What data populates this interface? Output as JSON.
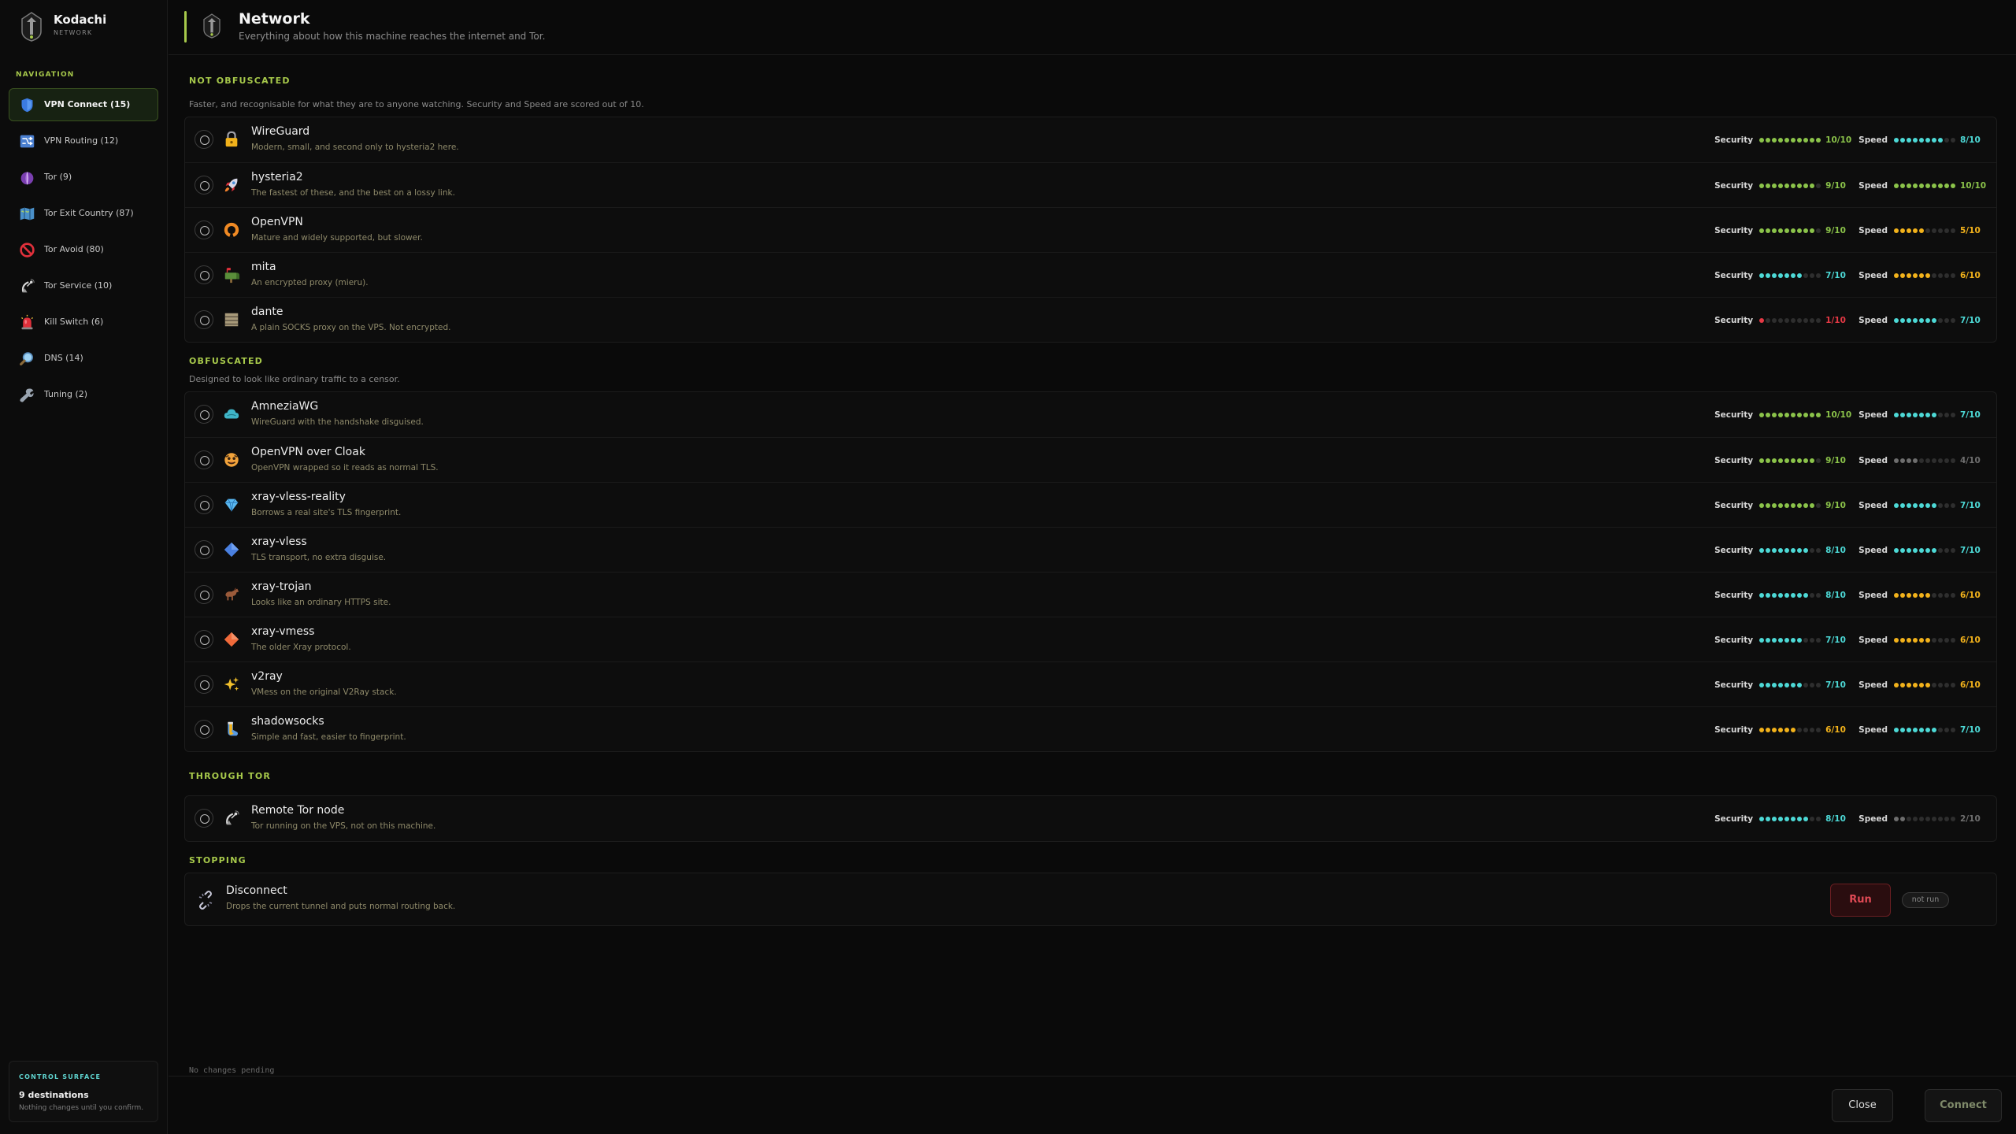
{
  "app": {
    "name": "Kodachi",
    "subtitle": "NETWORK"
  },
  "sidebar": {
    "heading": "NAVIGATION",
    "items": [
      {
        "label": "VPN Connect (15)",
        "icon": "shield-icon",
        "active": true
      },
      {
        "label": "VPN Routing (12)",
        "icon": "routing-icon",
        "active": false
      },
      {
        "label": "Tor (9)",
        "icon": "tor-onion-icon",
        "active": false
      },
      {
        "label": "Tor Exit Country (87)",
        "icon": "map-icon",
        "active": false
      },
      {
        "label": "Tor Avoid (80)",
        "icon": "prohibited-icon",
        "active": false
      },
      {
        "label": "Tor Service (10)",
        "icon": "satellite-icon",
        "active": false
      },
      {
        "label": "Kill Switch (6)",
        "icon": "alarm-icon",
        "active": false
      },
      {
        "label": "DNS (14)",
        "icon": "magnifier-icon",
        "active": false
      },
      {
        "label": "Tuning (2)",
        "icon": "wrench-icon",
        "active": false
      }
    ],
    "control": {
      "heading": "CONTROL SURFACE",
      "title": "9 destinations",
      "subtitle": "Nothing changes until you confirm."
    }
  },
  "header": {
    "title": "Network",
    "subtitle": "Everything about how this machine reaches the internet and Tor."
  },
  "labels": {
    "security": "Security",
    "speed": "Speed"
  },
  "colors": {
    "accent": "#a7c94b",
    "green": "#8bc34a",
    "cyan": "#4dd9d6",
    "yellow": "#f2b21b",
    "red": "#e53945",
    "gray": "#6e6e6e"
  },
  "sections": [
    {
      "heading": "NOT OBFUSCATED",
      "description": "Faster, and recognisable for what they are to anyone watching. Security and Speed are scored out of 10.",
      "protocols": [
        {
          "name": "WireGuard",
          "desc": "Modern, small, and second only to hysteria2 here.",
          "icon": "lock-icon",
          "security": 10,
          "speed": 8,
          "sec_color": "green",
          "spd_color": "cyan",
          "sec_text": "10/10",
          "spd_text": "8/10"
        },
        {
          "name": "hysteria2",
          "desc": "The fastest of these, and the best on a lossy link.",
          "icon": "rocket-icon",
          "security": 9,
          "speed": 10,
          "sec_color": "green",
          "spd_color": "green",
          "sec_text": "9/10",
          "spd_text": "10/10"
        },
        {
          "name": "OpenVPN",
          "desc": "Mature and widely supported, but slower.",
          "icon": "openvpn-icon",
          "security": 9,
          "speed": 5,
          "sec_color": "green",
          "spd_color": "yellow",
          "sec_text": "9/10",
          "spd_text": "5/10"
        },
        {
          "name": "mita",
          "desc": "An encrypted proxy (mieru).",
          "icon": "mailbox-icon",
          "security": 7,
          "speed": 6,
          "sec_color": "cyan",
          "spd_color": "yellow",
          "sec_text": "7/10",
          "spd_text": "6/10"
        },
        {
          "name": "dante",
          "desc": "A plain SOCKS proxy on the VPS. Not encrypted.",
          "icon": "server-icon",
          "security": 1,
          "speed": 7,
          "sec_color": "red",
          "spd_color": "cyan",
          "sec_text": "1/10",
          "spd_text": "7/10"
        }
      ]
    },
    {
      "heading": "OBFUSCATED",
      "description": "Designed to look like ordinary traffic to a censor.",
      "protocols": [
        {
          "name": "AmneziaWG",
          "desc": "WireGuard with the handshake disguised.",
          "icon": "cloud-icon",
          "security": 10,
          "speed": 7,
          "sec_color": "green",
          "spd_color": "cyan",
          "sec_text": "10/10",
          "spd_text": "7/10"
        },
        {
          "name": "OpenVPN over Cloak",
          "desc": "OpenVPN wrapped so it reads as normal TLS.",
          "icon": "mask-icon",
          "security": 9,
          "speed": 4,
          "sec_color": "green",
          "spd_color": "gray",
          "sec_text": "9/10",
          "spd_text": "4/10"
        },
        {
          "name": "xray-vless-reality",
          "desc": "Borrows a real site's TLS fingerprint.",
          "icon": "gem-icon",
          "security": 9,
          "speed": 7,
          "sec_color": "green",
          "spd_color": "cyan",
          "sec_text": "9/10",
          "spd_text": "7/10"
        },
        {
          "name": "xray-vless",
          "desc": "TLS transport, no extra disguise.",
          "icon": "blue-diamond-icon",
          "security": 8,
          "speed": 7,
          "sec_color": "cyan",
          "spd_color": "cyan",
          "sec_text": "8/10",
          "spd_text": "7/10"
        },
        {
          "name": "xray-trojan",
          "desc": "Looks like an ordinary HTTPS site.",
          "icon": "horse-icon",
          "security": 8,
          "speed": 6,
          "sec_color": "cyan",
          "spd_color": "yellow",
          "sec_text": "8/10",
          "spd_text": "6/10"
        },
        {
          "name": "xray-vmess",
          "desc": "The older Xray protocol.",
          "icon": "orange-diamond-icon",
          "security": 7,
          "speed": 6,
          "sec_color": "cyan",
          "spd_color": "yellow",
          "sec_text": "7/10",
          "spd_text": "6/10"
        },
        {
          "name": "v2ray",
          "desc": "VMess on the original V2Ray stack.",
          "icon": "sparkles-icon",
          "security": 7,
          "speed": 6,
          "sec_color": "cyan",
          "spd_color": "yellow",
          "sec_text": "7/10",
          "spd_text": "6/10"
        },
        {
          "name": "shadowsocks",
          "desc": "Simple and fast, easier to fingerprint.",
          "icon": "socks-icon",
          "security": 6,
          "speed": 7,
          "sec_color": "yellow",
          "spd_color": "cyan",
          "sec_text": "6/10",
          "spd_text": "7/10"
        }
      ]
    },
    {
      "heading": "THROUGH TOR",
      "description": "",
      "protocols": [
        {
          "name": "Remote Tor node",
          "desc": "Tor running on the VPS, not on this machine.",
          "icon": "satellite-icon",
          "security": 8,
          "speed": 2,
          "sec_color": "cyan",
          "spd_color": "gray",
          "sec_text": "8/10",
          "spd_text": "2/10"
        }
      ]
    }
  ],
  "stopping": {
    "heading": "STOPPING",
    "name": "Disconnect",
    "desc": "Drops the current tunnel and puts normal routing back.",
    "run_label": "Run",
    "status": "not run"
  },
  "pending": "No changes pending",
  "footer": {
    "close_label": "Close",
    "connect_label": "Connect"
  }
}
